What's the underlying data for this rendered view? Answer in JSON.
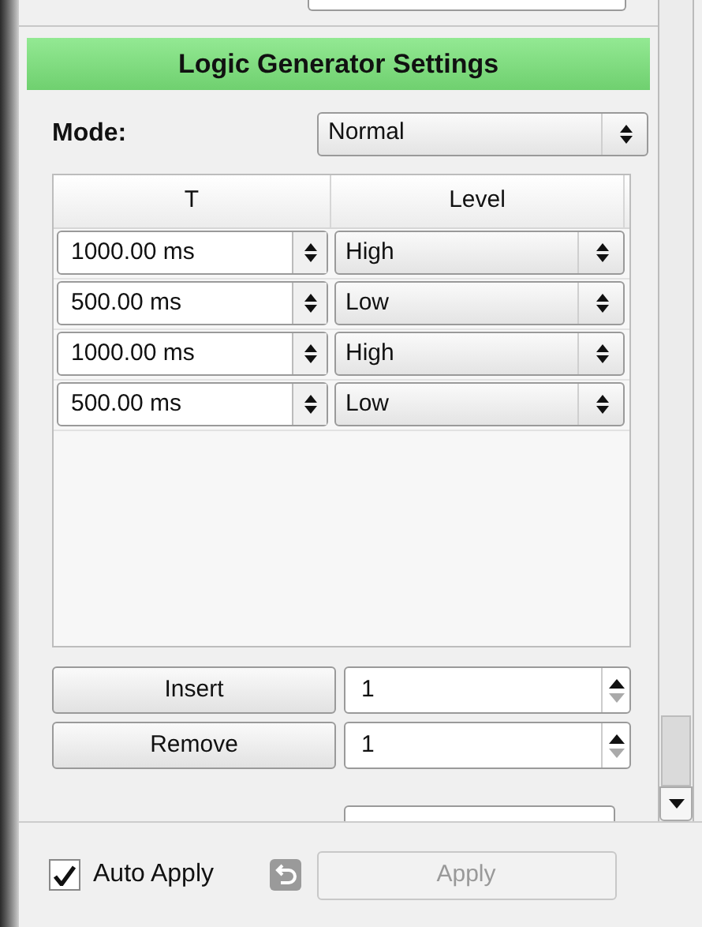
{
  "header": {
    "title": "Logic Generator Settings"
  },
  "mode": {
    "label": "Mode:",
    "value": "Normal"
  },
  "table": {
    "columns": [
      "T",
      "Level"
    ],
    "rows": [
      {
        "t": "1000.00 ms",
        "level": "High"
      },
      {
        "t": "500.00 ms",
        "level": "Low"
      },
      {
        "t": "1000.00 ms",
        "level": "High"
      },
      {
        "t": "500.00 ms",
        "level": "Low"
      }
    ]
  },
  "actions": [
    {
      "label": "Insert",
      "value": "1"
    },
    {
      "label": "Remove",
      "value": "1"
    }
  ],
  "auto_apply": {
    "label": "Auto Apply",
    "checked": true
  },
  "apply": {
    "label": "Apply",
    "disabled": true
  }
}
